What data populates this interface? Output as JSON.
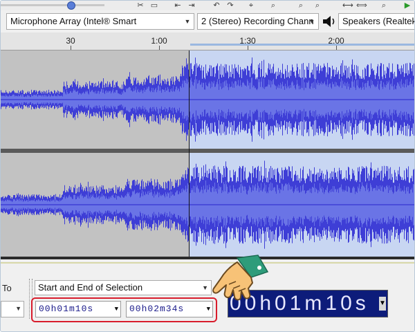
{
  "devices": {
    "mic": "Microphone Array (Intel® Smart",
    "channels": "2 (Stereo) Recording Chann",
    "speakers": "Speakers (Realtek("
  },
  "ruler": {
    "labels": [
      "30",
      "1:00",
      "1:30",
      "2:00"
    ]
  },
  "selection": {
    "to_label": "To",
    "mode": "Start and End of Selection",
    "start_time": "00h01m10s",
    "end_time": "00h02m34s"
  },
  "audio_position": {
    "time": "00h01m10s"
  },
  "icons": {
    "speaker": "speaker-icon",
    "pointer": "pointing-hand-icon"
  },
  "colors": {
    "waveform": "#3e3ed6",
    "waveform_rms": "#6a74e6",
    "track_bg": "#c8d6f2",
    "selection_bg": "#c2c2c2",
    "highlight": "#d81c2c",
    "time_display_bg": "#0d1c7a"
  }
}
